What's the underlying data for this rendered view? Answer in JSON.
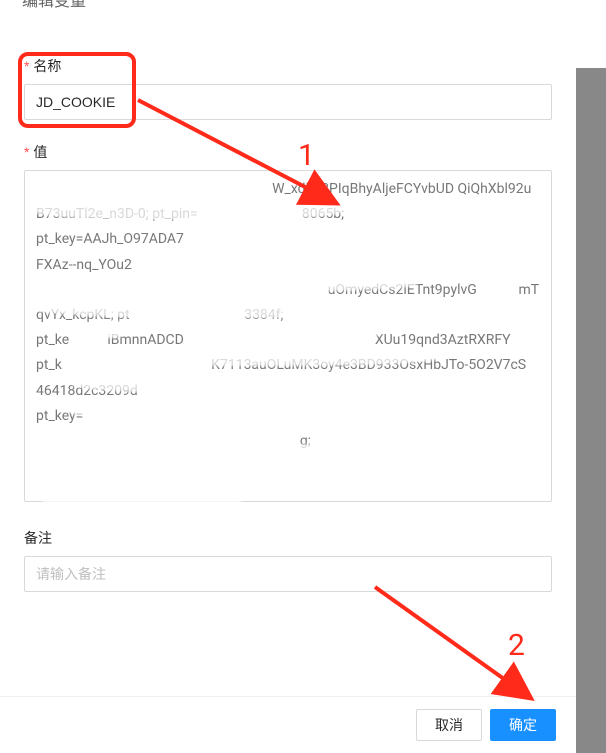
{
  "modal": {
    "title": "编辑变量",
    "close_icon": "×"
  },
  "form": {
    "name_label": "名称",
    "name_value": "JD_COOKIE",
    "value_label": "值",
    "value_text": "                                                                    W_xdh92PIqBhyAljeFCYvbUD QiQhXbl92uB73uuTl2e_n3D-0; pt_pin=                              8065b;\npt_key=AAJh_O97ADA7\nFXAz--nq_YOu2\n                                                                                    uOmyedCs2lETnt9pylvG            mTqvYx_kcpKL; pt                                 3384f;\npt_ke           iBmnnADCD                                                       XUu19qnd3AztRXRFY\npt_k                                           K7113auOLuMK3oy4e3BD933OsxHbJTo-5O2V7cS                                                          46418d2c3209d\npt_key=\n                                                                            g;",
    "remark_label": "备注",
    "remark_placeholder": "请输入备注"
  },
  "footer": {
    "cancel_label": "取消",
    "confirm_label": "确定"
  },
  "annotations": {
    "label1": "1",
    "label2": "2"
  }
}
